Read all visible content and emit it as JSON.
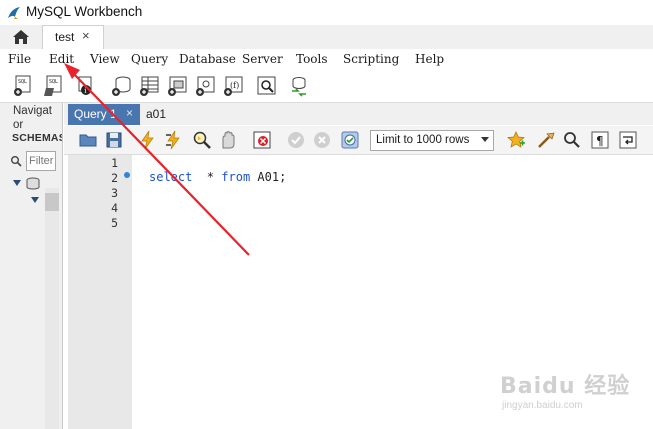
{
  "window": {
    "title": "MySQL Workbench"
  },
  "tabs": {
    "home_icon": "house-icon",
    "connection_tab": "test",
    "close_glyph": "×"
  },
  "menu": [
    "File",
    "Edit",
    "View",
    "Query",
    "Database",
    "Server",
    "Tools",
    "Scripting",
    "Help"
  ],
  "toolbar": {
    "icons": [
      "new-sql-tab-icon",
      "open-sql-script-icon",
      "inspect-icon",
      "create-schema-icon",
      "create-table-icon",
      "create-view-icon",
      "create-procedure-icon",
      "create-function-icon",
      "search-table-data-icon",
      "reconnect-icon"
    ]
  },
  "sidebar": {
    "title": "Navigator",
    "schemas_label": "SCHEMAS",
    "filter_placeholder": "Filter"
  },
  "query_tabs": {
    "active": "Query 1",
    "second": "a01"
  },
  "editor_toolbar": {
    "limit_label": "Limit to 1000 rows"
  },
  "editor": {
    "line_numbers": [
      "1",
      "2",
      "3",
      "4",
      "5"
    ],
    "code": {
      "kw1": "select",
      "mid": "  * ",
      "kw2": "from",
      "rest": " A01;"
    }
  },
  "watermark": {
    "logo": "Baidu 经验",
    "url": "jingyan.baidu.com"
  },
  "colors": {
    "active_tab": "#4a76b0",
    "keyword": "#1b53c9",
    "annotation_arrow": "#e8232b",
    "exec_dot": "#2e86d6"
  }
}
